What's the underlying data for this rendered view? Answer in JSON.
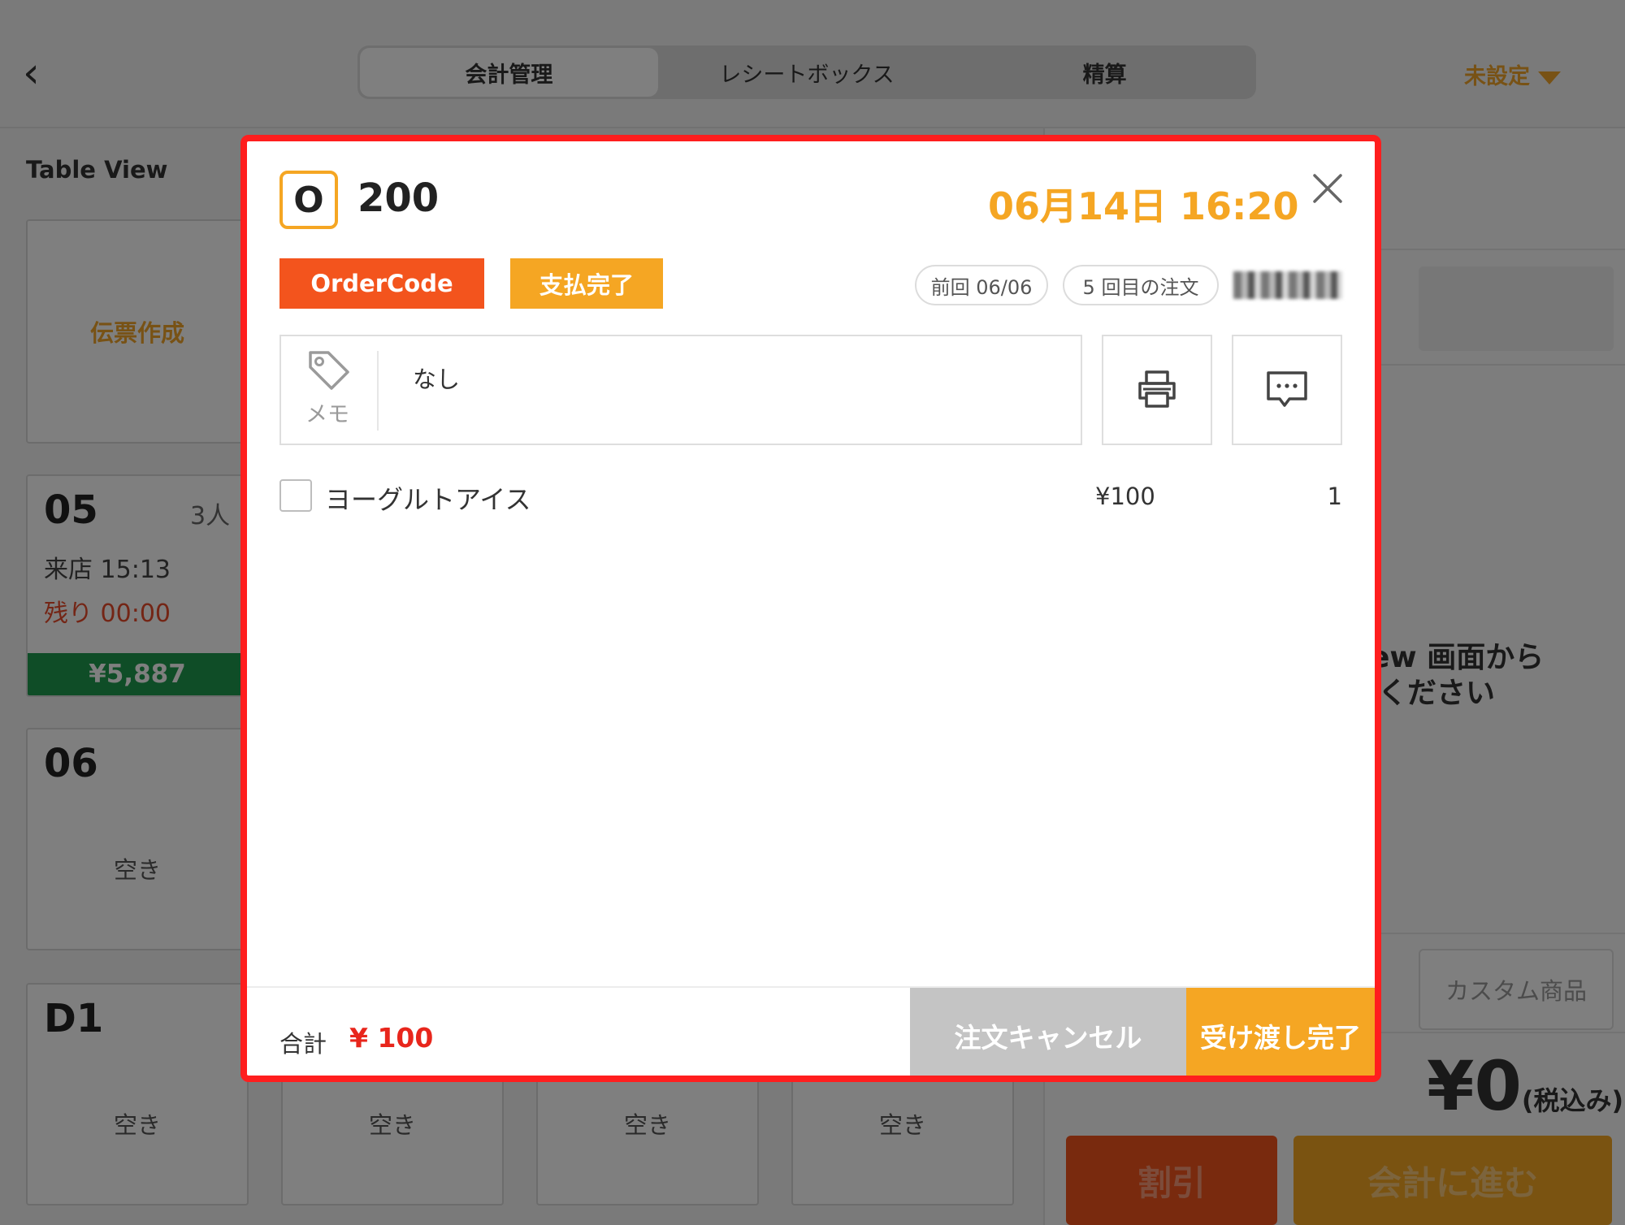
{
  "header": {
    "tabs": [
      {
        "label": "会計管理"
      },
      {
        "label": "レシートボックス"
      },
      {
        "label": "精算"
      }
    ],
    "store_selector": "未設定"
  },
  "table_view": {
    "title": "Table View",
    "create_slip": "伝票作成",
    "tables": [
      {
        "number": "05",
        "people": "3人",
        "visit": "来店 15:13",
        "remaining": "残り 00:00",
        "amount": "¥5,887"
      },
      {
        "number": "06",
        "status": "空き"
      },
      {
        "number": "D1",
        "status": "空き"
      }
    ],
    "bottom_row_status": [
      "空き",
      "空き",
      "空き"
    ]
  },
  "right_panel": {
    "hint_line1": "ew 画面から",
    "hint_line2": "ください",
    "custom_item": "カスタム商品",
    "total": "¥0",
    "tax_note": "(税込み)",
    "discount_button": "割引",
    "checkout_button": "会計に進む"
  },
  "modal": {
    "order_type": "O",
    "order_number": "200",
    "datetime": "06月14日 16:20",
    "tags": {
      "order_code": "OrderCode",
      "payment_status": "支払完了"
    },
    "previous_visit": "前回 06/06",
    "order_count": "5 回目の注文",
    "memo": {
      "label": "メモ",
      "text": "なし"
    },
    "items": [
      {
        "name": "ヨーグルトアイス",
        "price": "¥100",
        "qty": "1",
        "checked": false
      }
    ],
    "footer": {
      "total_label": "合計",
      "total_value": "¥ 100",
      "cancel_button": "注文キャンセル",
      "complete_button": "受け渡し完了"
    }
  },
  "colors": {
    "accent_orange": "#f5a623",
    "order_code_red": "#f3541d",
    "highlight_border": "#ff1e1e",
    "price_green": "#1f9a4e",
    "total_red": "#e8261c"
  }
}
